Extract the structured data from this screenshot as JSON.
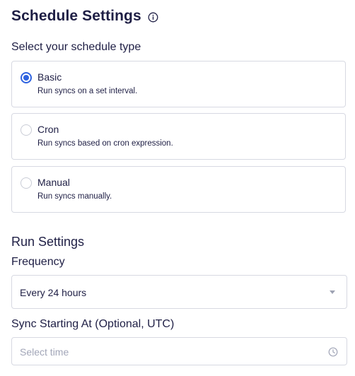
{
  "schedule": {
    "title": "Schedule Settings",
    "info_icon": "info-icon",
    "type_label": "Select your schedule type",
    "options": [
      {
        "title": "Basic",
        "description": "Run syncs on a set interval.",
        "selected": true
      },
      {
        "title": "Cron",
        "description": "Run syncs based on cron expression.",
        "selected": false
      },
      {
        "title": "Manual",
        "description": "Run syncs manually.",
        "selected": false
      }
    ]
  },
  "run": {
    "title": "Run Settings",
    "frequency_label": "Frequency",
    "frequency_value": "Every 24 hours",
    "sync_label": "Sync Starting At (Optional, UTC)",
    "sync_placeholder": "Select time",
    "sync_value": "",
    "clock_icon": "clock-icon"
  },
  "colors": {
    "accent": "#2f63e0",
    "text": "#1f1f45",
    "border": "#d7d9e2",
    "placeholder": "#a2a6b8"
  }
}
